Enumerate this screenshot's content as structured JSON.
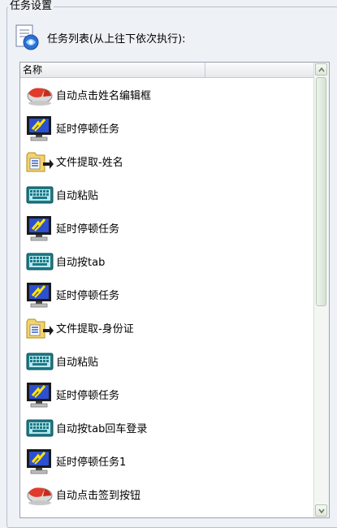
{
  "group": {
    "title": "任务设置"
  },
  "header": {
    "label": "任务列表(从上往下依次执行):",
    "icon": "task-list-icon"
  },
  "list": {
    "column_name": "名称",
    "items": [
      {
        "label": "自动点击姓名编辑框",
        "icon": "mouse-icon"
      },
      {
        "label": "延时停顿任务",
        "icon": "monitor-delay-icon"
      },
      {
        "label": "文件提取-姓名",
        "icon": "file-extract-icon"
      },
      {
        "label": "自动粘贴",
        "icon": "keyboard-icon"
      },
      {
        "label": "延时停顿任务",
        "icon": "monitor-delay-icon"
      },
      {
        "label": "自动按tab",
        "icon": "keyboard-icon"
      },
      {
        "label": "延时停顿任务",
        "icon": "monitor-delay-icon"
      },
      {
        "label": "文件提取-身份证",
        "icon": "file-extract-icon"
      },
      {
        "label": "自动粘贴",
        "icon": "keyboard-icon"
      },
      {
        "label": "延时停顿任务",
        "icon": "monitor-delay-icon"
      },
      {
        "label": "自动按tab回车登录",
        "icon": "keyboard-icon"
      },
      {
        "label": "延时停顿任务1",
        "icon": "monitor-delay-icon"
      },
      {
        "label": "自动点击签到按钮",
        "icon": "mouse-icon"
      }
    ]
  },
  "colors": {
    "background": "#eef1f6",
    "list_bg": "#ffffff",
    "scroll": "#d6e3d2"
  }
}
